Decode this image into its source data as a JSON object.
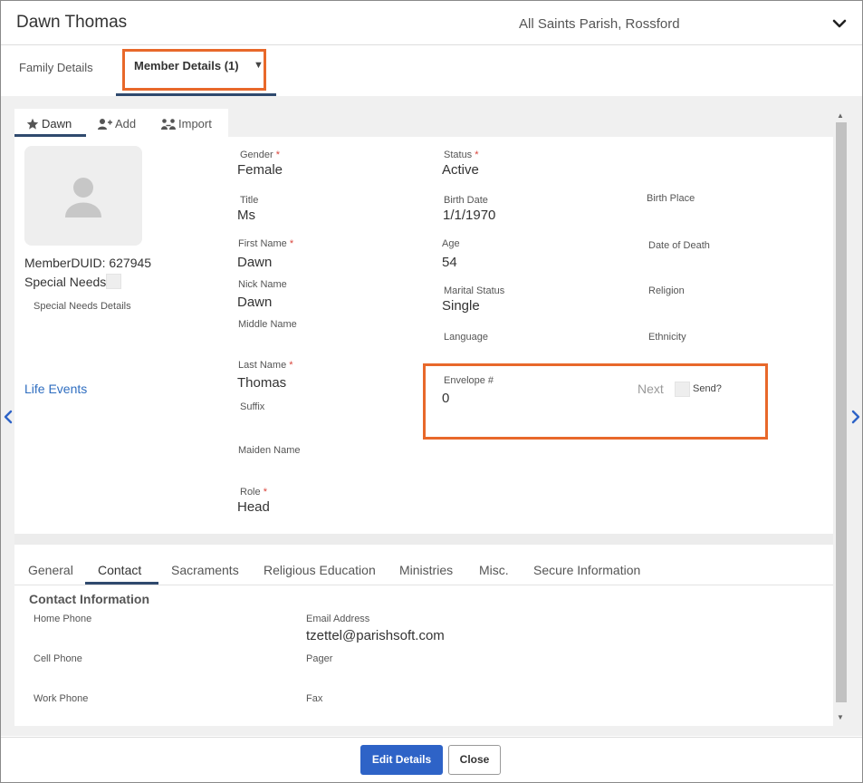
{
  "header": {
    "member_name": "Dawn Thomas",
    "parish": "All Saints Parish, Rossford",
    "collapse_icon": "chevron-down-icon"
  },
  "main_tabs": {
    "family_details": "Family Details",
    "member_details": "Member Details (1)",
    "member_dropdown_icon": "caret-down-icon"
  },
  "member_subtabs": {
    "current": "Dawn",
    "add": "Add",
    "import": "Import"
  },
  "profile": {
    "member_duid": "MemberDUID: 627945",
    "special_needs_label": "Special Needs",
    "special_needs_details_label": "Special Needs Details",
    "life_events_link": "Life Events"
  },
  "fields": {
    "gender": {
      "label": "Gender",
      "value": "Female",
      "required": "*"
    },
    "status": {
      "label": "Status",
      "value": "Active",
      "required": "*"
    },
    "title": {
      "label": "Title",
      "value": "Ms"
    },
    "birth_date": {
      "label": "Birth Date",
      "value": "1/1/1970"
    },
    "birth_place": {
      "label": "Birth Place",
      "value": ""
    },
    "first_name": {
      "label": "First Name",
      "value": "Dawn",
      "required": "*"
    },
    "age": {
      "label": "Age",
      "value": "54"
    },
    "date_of_death": {
      "label": "Date of Death",
      "value": ""
    },
    "nick_name": {
      "label": "Nick Name",
      "value": "Dawn"
    },
    "marital_status": {
      "label": "Marital Status",
      "value": "Single"
    },
    "religion": {
      "label": "Religion",
      "value": ""
    },
    "middle_name": {
      "label": "Middle Name",
      "value": ""
    },
    "language": {
      "label": "Language",
      "value": ""
    },
    "ethnicity": {
      "label": "Ethnicity",
      "value": ""
    },
    "last_name": {
      "label": "Last Name",
      "value": "Thomas",
      "required": "*"
    },
    "envelope": {
      "label": "Envelope #",
      "value": "0"
    },
    "suffix": {
      "label": "Suffix",
      "value": ""
    },
    "maiden_name": {
      "label": "Maiden Name",
      "value": ""
    },
    "role": {
      "label": "Role",
      "value": "Head",
      "required": "*"
    }
  },
  "envelope_actions": {
    "next": "Next",
    "send": "Send?"
  },
  "bottom_tabs": [
    "General",
    "Contact",
    "Sacraments",
    "Religious Education",
    "Ministries",
    "Misc.",
    "Secure Information"
  ],
  "active_bottom_tab": "Contact",
  "contact": {
    "title": "Contact Information",
    "home_phone": {
      "label": "Home Phone",
      "value": ""
    },
    "email": {
      "label": "Email Address",
      "value": "tzettel@parishsoft.com"
    },
    "cell_phone": {
      "label": "Cell Phone",
      "value": ""
    },
    "pager": {
      "label": "Pager",
      "value": ""
    },
    "work_phone": {
      "label": "Work Phone",
      "value": ""
    },
    "fax": {
      "label": "Fax",
      "value": ""
    }
  },
  "footer": {
    "edit_button": "Edit Details",
    "close_button": "Close"
  },
  "colors": {
    "primary_button": "#2e63c7",
    "tab_underline": "#2f4a6e",
    "highlight_box": "#e8682a",
    "required_marker": "#d9443b",
    "link": "#2f6ec0"
  }
}
